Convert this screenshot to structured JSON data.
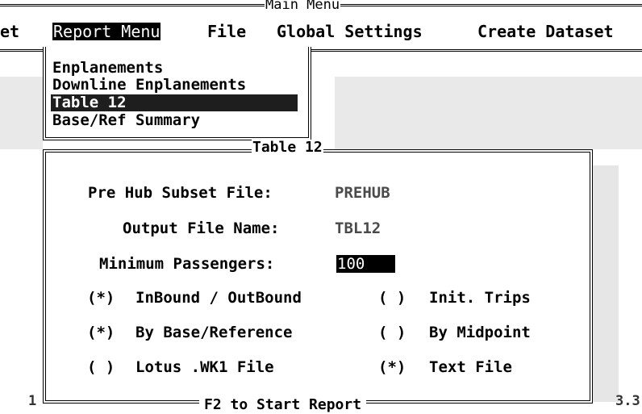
{
  "main_menu": {
    "title": "Main Menu",
    "items": [
      {
        "label": "et"
      },
      {
        "label": "Report Menu"
      },
      {
        "label": "File"
      },
      {
        "label": "Global Settings"
      },
      {
        "label": "Create Dataset"
      }
    ]
  },
  "report_menu": {
    "items": [
      {
        "label": "Enplanements"
      },
      {
        "label": "Downline Enplanements"
      },
      {
        "label": "Table 12"
      },
      {
        "label": "Base/Ref Summary"
      }
    ]
  },
  "dialog": {
    "title": "Table 12",
    "fields": [
      {
        "label": "Pre Hub Subset File:",
        "value": "PREHUB"
      },
      {
        "label": "Output File Name:",
        "value": "TBL12"
      },
      {
        "label": "Minimum Passengers:",
        "value": "100"
      }
    ],
    "options": [
      {
        "left": {
          "mark": "(*)",
          "label": "InBound / OutBound"
        },
        "right": {
          "mark": "( )",
          "label": "Init. Trips"
        }
      },
      {
        "left": {
          "mark": "(*)",
          "label": "By Base/Reference"
        },
        "right": {
          "mark": "( )",
          "label": "By Midpoint"
        }
      },
      {
        "left": {
          "mark": "( )",
          "label": "Lotus .WK1 File"
        },
        "right": {
          "mark": "(*)",
          "label": "Text File"
        }
      }
    ],
    "footer": "F2 to Start Report"
  },
  "status": {
    "left": "1",
    "right": "3.3"
  }
}
